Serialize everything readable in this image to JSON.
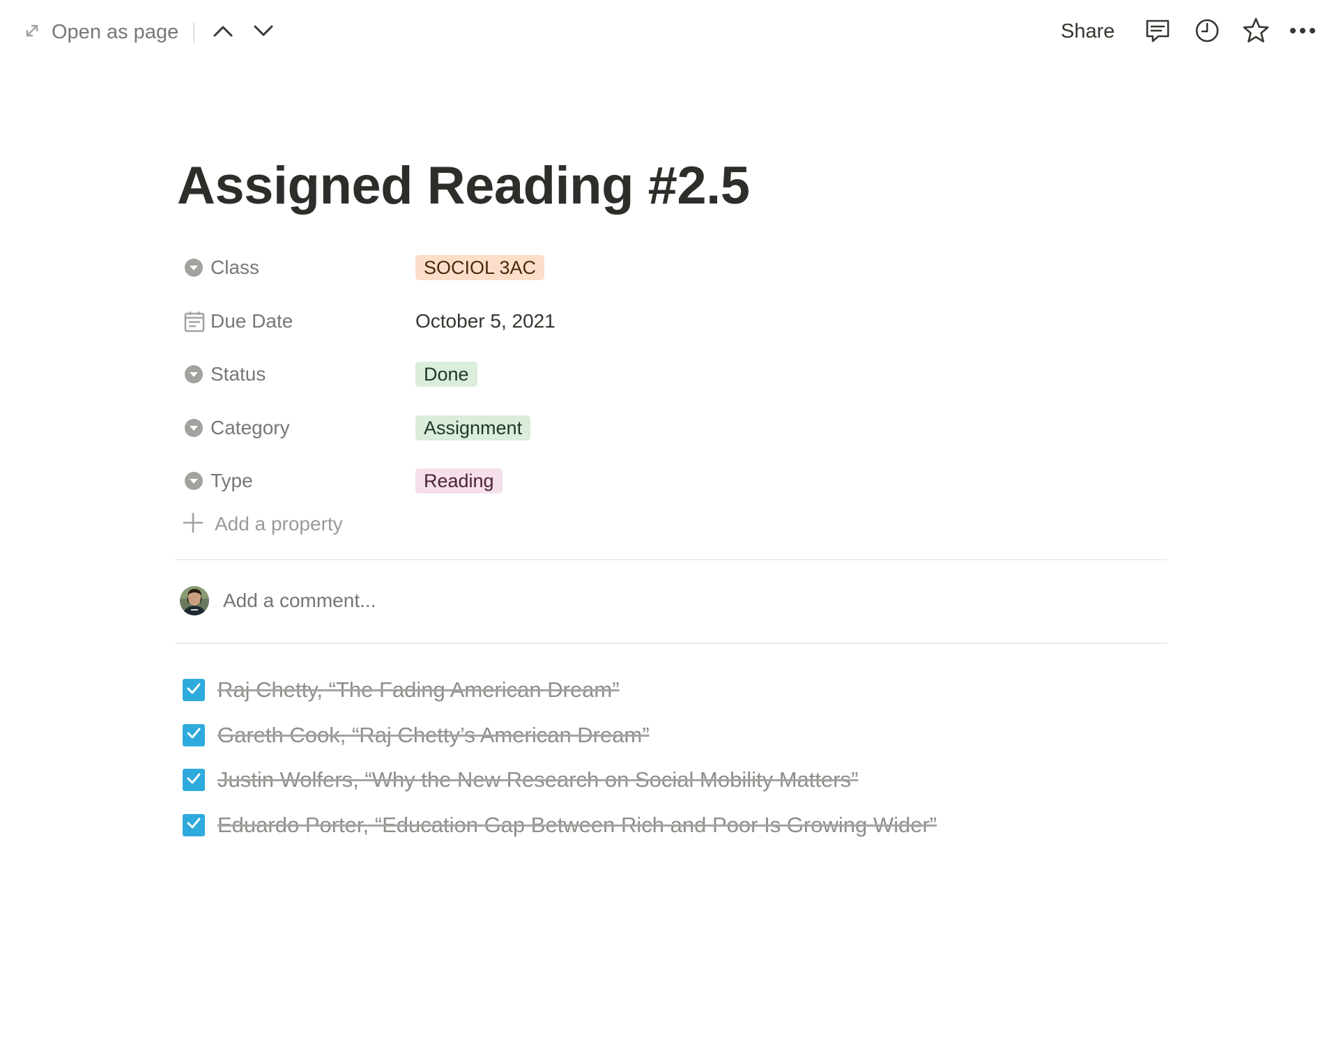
{
  "topbar": {
    "open_as_page_label": "Open as page",
    "share_label": "Share",
    "icons": [
      "expand-icon",
      "chevron-up-icon",
      "chevron-down-icon",
      "comments-icon",
      "clock-icon",
      "star-icon",
      "more-icon"
    ]
  },
  "page": {
    "title": "Assigned Reading #2.5"
  },
  "properties": [
    {
      "name": "Class",
      "icon": "select-icon",
      "value": "SOCIOL 3AC",
      "kind": "tag",
      "tag_bg": "#fadec9",
      "tag_fg": "#49290e"
    },
    {
      "name": "Due Date",
      "icon": "calendar-icon",
      "value": "October 5, 2021",
      "kind": "text"
    },
    {
      "name": "Status",
      "icon": "select-icon",
      "value": "Done",
      "kind": "tag",
      "tag_bg": "#dbeddb",
      "tag_fg": "#1c3829"
    },
    {
      "name": "Category",
      "icon": "select-icon",
      "value": "Assignment",
      "kind": "tag",
      "tag_bg": "#dbeddb",
      "tag_fg": "#1c3829"
    },
    {
      "name": "Type",
      "icon": "select-icon",
      "value": "Reading",
      "kind": "tag",
      "tag_bg": "#f4dfeb",
      "tag_fg": "#4c2337"
    }
  ],
  "add_property_label": "Add a property",
  "comment": {
    "placeholder": "Add a comment..."
  },
  "todos": [
    {
      "text": "Raj Chetty, “The Fading American Dream”",
      "checked": true
    },
    {
      "text": "Gareth Cook, “Raj Chetty’s American Dream”",
      "checked": true
    },
    {
      "text": "Justin Wolfers, “Why the New Research on Social Mobility Matters”",
      "checked": true
    },
    {
      "text": "Eduardo Porter, “Education Gap Between Rich and Poor Is Growing Wider”",
      "checked": true
    }
  ],
  "colors": {
    "checkbox": "#2eaadc",
    "text_primary": "#37352f",
    "text_secondary": "#787774"
  }
}
